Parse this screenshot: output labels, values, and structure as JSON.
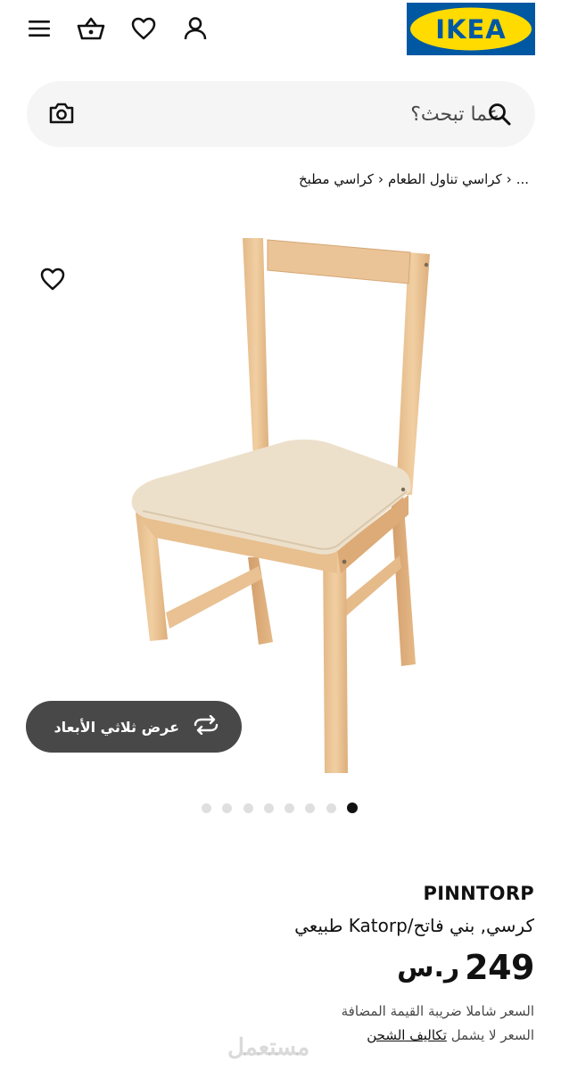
{
  "header": {
    "icons": [
      "menu-icon",
      "basket-icon",
      "heart-icon",
      "user-icon"
    ],
    "logo_text": "IKEA",
    "brand_colors": {
      "blue": "#0058a3",
      "yellow": "#ffdb00"
    }
  },
  "search": {
    "placeholder": "عما تبحث؟",
    "icons": [
      "search-icon",
      "camera-icon"
    ]
  },
  "breadcrumb": {
    "items": [
      "...",
      "كراسي تناول الطعام",
      "كراسي مطبخ"
    ]
  },
  "gallery": {
    "view3d_label": "عرض ثلاثي الأبعاد",
    "slide_count": 8,
    "active_slide": 1
  },
  "product": {
    "name": "PINNTORP",
    "description": "كرسي, بني فاتح/Katorp طبيعي",
    "price": "249",
    "currency": "ر.س",
    "vat_note": "السعر شاملا ضريبة القيمة المضافة",
    "shipping_prefix": "السعر لا يشمل",
    "shipping_link": "تكاليف الشحن"
  },
  "watermark": "مستعمل"
}
